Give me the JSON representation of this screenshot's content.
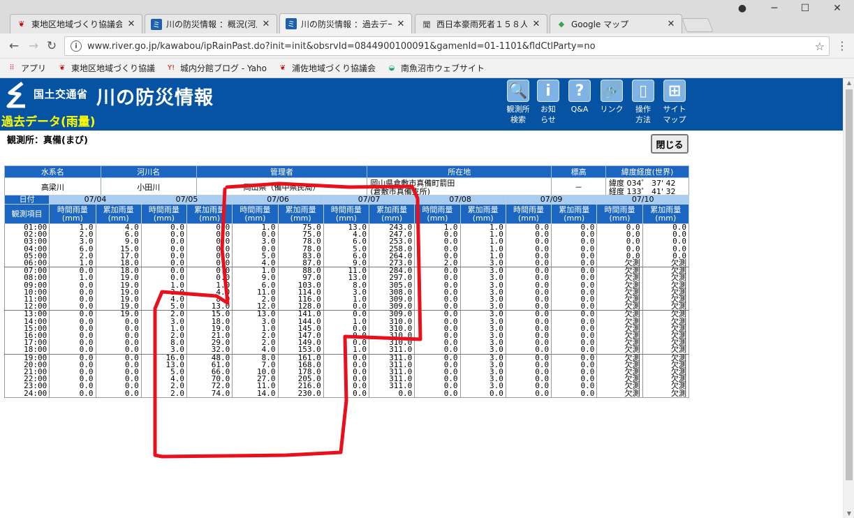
{
  "browser": {
    "tabs": [
      {
        "title": "東地区地域づくり協議会ブロ",
        "icon": "japan-icon",
        "active": false
      },
      {
        "title": "川の防災情報 ：概況(河川",
        "icon": "river-icon",
        "active": false
      },
      {
        "title": "川の防災情報 ：過去デー",
        "icon": "river-icon",
        "active": true
      },
      {
        "title": "西日本豪雨死者１５８人",
        "icon": "news-icon",
        "active": false
      },
      {
        "title": "Google マップ",
        "icon": "maps-icon",
        "active": false
      }
    ],
    "url": "www.river.go.jp/kawabou/ipRainPast.do?init=init&obsrvId=0844900100091&gamenId=01-1101&fldCtlParty=no",
    "bookmarks": [
      {
        "label": "アプリ",
        "icon": "apps-grid-icon"
      },
      {
        "label": "東地区地域づくり協議",
        "icon": "japan-icon"
      },
      {
        "label": "城内分館ブログ - Yaho",
        "icon": "yahoo-icon"
      },
      {
        "label": "浦佐地域づくり協議会",
        "icon": "japan-icon"
      },
      {
        "label": "南魚沼市ウェブサイト",
        "icon": "city-icon"
      }
    ]
  },
  "header": {
    "ministry": "国土交通省",
    "site_name": "川の防災情報",
    "page_type": "過去データ(雨量)",
    "nav": [
      {
        "line1": "観測所",
        "line2": "検索",
        "icon": "magnifier-icon",
        "glyph": "🔍"
      },
      {
        "line1": "お知",
        "line2": "らせ",
        "icon": "info-icon",
        "glyph": "i"
      },
      {
        "line1": "Q&A",
        "line2": "",
        "icon": "question-icon",
        "glyph": "?"
      },
      {
        "line1": "リンク",
        "line2": "",
        "icon": "link-icon",
        "glyph": "🔗"
      },
      {
        "line1": "操作",
        "line2": "方法",
        "icon": "mouse-icon",
        "glyph": "▯"
      },
      {
        "line1": "サイト",
        "line2": "マップ",
        "icon": "sitemap-icon",
        "glyph": "⊞"
      }
    ]
  },
  "station_label": "観測所：真備(まび)",
  "close_label": "閉じる",
  "info": {
    "headers": [
      "水系名",
      "河川名",
      "管理者",
      "所在地",
      "標高",
      "緯度経度(世界)"
    ],
    "system": "高梁川",
    "river": "小田川",
    "manager": "岡山県（備中県民局）",
    "location1": "岡山県倉敷市真備町箭田",
    "location2": "(倉敷市真備支所)",
    "elevation": "－",
    "lat": "緯度 034゜ 37' 42",
    "lon": "経度 133゜ 41' 32"
  },
  "rain": {
    "date_label": "日付",
    "item_label": "観測項目",
    "col_hourly": "時間雨量",
    "col_cumulative": "累加雨量",
    "unit": "(mm)",
    "dates": [
      "07/04",
      "07/05",
      "07/06",
      "07/07",
      "07/08",
      "07/09",
      "07/10"
    ],
    "rows": [
      [
        "01:00",
        "1.0",
        "4.0",
        "0.0",
        "0.0",
        "1.0",
        "75.0",
        "13.0",
        "243.0",
        "1.0",
        "1.0",
        "0.0",
        "0.0",
        "0.0",
        "0.0"
      ],
      [
        "02:00",
        "2.0",
        "6.0",
        "0.0",
        "0.0",
        "0.0",
        "75.0",
        "4.0",
        "247.0",
        "0.0",
        "1.0",
        "0.0",
        "0.0",
        "0.0",
        "0.0"
      ],
      [
        "03:00",
        "3.0",
        "9.0",
        "0.0",
        "0.0",
        "3.0",
        "78.0",
        "6.0",
        "253.0",
        "0.0",
        "1.0",
        "0.0",
        "0.0",
        "0.0",
        "0.0"
      ],
      [
        "04:00",
        "6.0",
        "15.0",
        "0.0",
        "0.0",
        "0.0",
        "78.0",
        "5.0",
        "258.0",
        "0.0",
        "1.0",
        "0.0",
        "0.0",
        "0.0",
        "0.0"
      ],
      [
        "05:00",
        "2.0",
        "17.0",
        "0.0",
        "0.0",
        "5.0",
        "83.0",
        "6.0",
        "264.0",
        "0.0",
        "1.0",
        "0.0",
        "0.0",
        "0.0",
        "0.0"
      ],
      [
        "06:00",
        "1.0",
        "18.0",
        "0.0",
        "0.0",
        "4.0",
        "87.0",
        "9.0",
        "273.0",
        "2.0",
        "3.0",
        "0.0",
        "0.0",
        "欠測",
        "欠測"
      ],
      [
        "07:00",
        "0.0",
        "18.0",
        "0.0",
        "0.0",
        "1.0",
        "88.0",
        "11.0",
        "284.0",
        "0.0",
        "3.0",
        "0.0",
        "0.0",
        "欠測",
        "欠測"
      ],
      [
        "08:00",
        "1.0",
        "19.0",
        "0.0",
        "0.0",
        "9.0",
        "97.0",
        "13.0",
        "297.0",
        "0.0",
        "3.0",
        "0.0",
        "0.0",
        "欠測",
        "欠測"
      ],
      [
        "09:00",
        "0.0",
        "19.0",
        "1.0",
        "1.0",
        "6.0",
        "103.0",
        "8.0",
        "305.0",
        "0.0",
        "3.0",
        "0.0",
        "0.0",
        "欠測",
        "欠測"
      ],
      [
        "10:00",
        "0.0",
        "19.0",
        "3.0",
        "4.0",
        "11.0",
        "114.0",
        "3.0",
        "308.0",
        "0.0",
        "3.0",
        "0.0",
        "0.0",
        "欠測",
        "欠測"
      ],
      [
        "11:00",
        "0.0",
        "19.0",
        "4.0",
        "8.0",
        "2.0",
        "116.0",
        "1.0",
        "309.0",
        "0.0",
        "3.0",
        "0.0",
        "0.0",
        "欠測",
        "欠測"
      ],
      [
        "12:00",
        "0.0",
        "19.0",
        "5.0",
        "13.0",
        "12.0",
        "128.0",
        "0.0",
        "309.0",
        "0.0",
        "3.0",
        "0.0",
        "0.0",
        "欠測",
        "欠測"
      ],
      [
        "13:00",
        "0.0",
        "19.0",
        "2.0",
        "15.0",
        "13.0",
        "141.0",
        "0.0",
        "309.0",
        "0.0",
        "3.0",
        "0.0",
        "0.0",
        "欠測",
        "欠測"
      ],
      [
        "14:00",
        "0.0",
        "0.0",
        "3.0",
        "18.0",
        "3.0",
        "144.0",
        "1.0",
        "310.0",
        "0.0",
        "3.0",
        "0.0",
        "0.0",
        "欠測",
        "欠測"
      ],
      [
        "15:00",
        "0.0",
        "0.0",
        "1.0",
        "19.0",
        "1.0",
        "145.0",
        "0.0",
        "310.0",
        "0.0",
        "3.0",
        "0.0",
        "0.0",
        "欠測",
        "欠測"
      ],
      [
        "16:00",
        "0.0",
        "0.0",
        "2.0",
        "21.0",
        "2.0",
        "147.0",
        "0.0",
        "310.0",
        "0.0",
        "3.0",
        "0.0",
        "0.0",
        "欠測",
        "欠測"
      ],
      [
        "17:00",
        "0.0",
        "0.0",
        "8.0",
        "29.0",
        "2.0",
        "149.0",
        "0.0",
        "310.0",
        "0.0",
        "3.0",
        "0.0",
        "0.0",
        "欠測",
        "欠測"
      ],
      [
        "18:00",
        "0.0",
        "0.0",
        "3.0",
        "32.0",
        "4.0",
        "153.0",
        "1.0",
        "311.0",
        "0.0",
        "3.0",
        "0.0",
        "0.0",
        "欠測",
        "欠測"
      ],
      [
        "19:00",
        "0.0",
        "0.0",
        "16.0",
        "48.0",
        "8.0",
        "161.0",
        "0.0",
        "311.0",
        "0.0",
        "3.0",
        "0.0",
        "0.0",
        "欠測",
        "欠測"
      ],
      [
        "20:00",
        "0.0",
        "0.0",
        "13.0",
        "61.0",
        "7.0",
        "168.0",
        "0.0",
        "311.0",
        "0.0",
        "3.0",
        "0.0",
        "0.0",
        "欠測",
        "欠測"
      ],
      [
        "21:00",
        "0.0",
        "0.0",
        "5.0",
        "66.0",
        "10.0",
        "178.0",
        "0.0",
        "311.0",
        "0.0",
        "3.0",
        "0.0",
        "0.0",
        "欠測",
        "欠測"
      ],
      [
        "22:00",
        "0.0",
        "0.0",
        "4.0",
        "70.0",
        "27.0",
        "205.0",
        "0.0",
        "311.0",
        "0.0",
        "3.0",
        "0.0",
        "0.0",
        "欠測",
        "欠測"
      ],
      [
        "23:00",
        "0.0",
        "0.0",
        "2.0",
        "72.0",
        "11.0",
        "216.0",
        "0.0",
        "311.0",
        "0.0",
        "3.0",
        "0.0",
        "0.0",
        "欠測",
        "欠測"
      ],
      [
        "24:00",
        "0.0",
        "0.0",
        "2.0",
        "74.0",
        "14.0",
        "230.0",
        "0.0",
        "0.0",
        "0.0",
        "0.0",
        "0.0",
        "0.0",
        "欠測",
        "欠測"
      ]
    ]
  },
  "annotation_color": "#e8101c"
}
